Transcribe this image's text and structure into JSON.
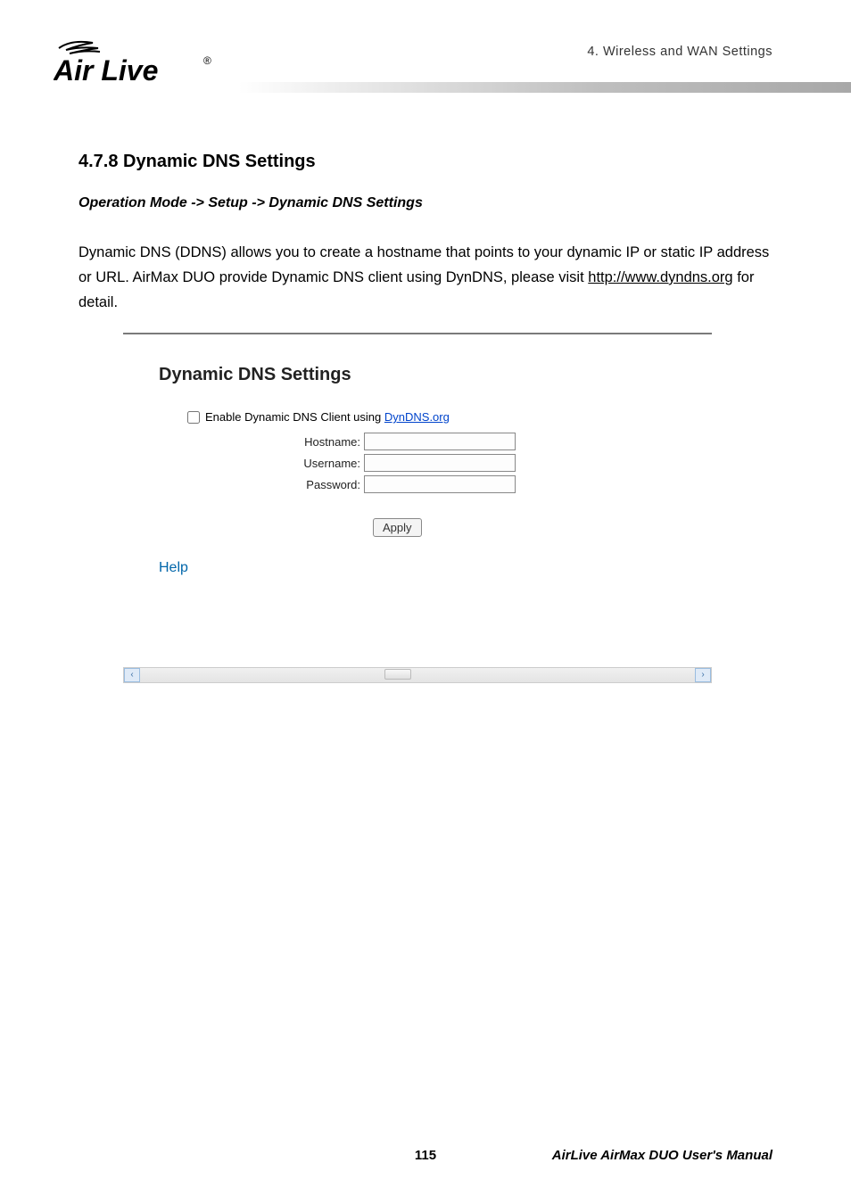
{
  "header": {
    "chapter_label": "4. Wireless and WAN Settings",
    "logo_text_main": "Air Live",
    "logo_reg": "®"
  },
  "content": {
    "section_heading": "4.7.8 Dynamic DNS Settings",
    "breadcrumb": "Operation Mode -> Setup -> Dynamic DNS Settings",
    "body_pre": "Dynamic DNS (DDNS) allows you to create a hostname that points to your dynamic IP or static IP address or URL. AirMax DUO provide Dynamic DNS client using DynDNS, please visit ",
    "body_link": "http://www.dyndns.org",
    "body_post": " for detail."
  },
  "panel": {
    "title": "Dynamic DNS Settings",
    "enable_label_pre": "Enable Dynamic DNS Client using ",
    "enable_link": "DynDNS.org",
    "enable_checked": false,
    "hostname_label": "Hostname:",
    "hostname_value": "",
    "username_label": "Username:",
    "username_value": "",
    "password_label": "Password:",
    "password_value": "",
    "apply_label": "Apply",
    "help_label": "Help"
  },
  "footer": {
    "page_number": "115",
    "manual_name": "AirLive AirMax DUO User's Manual"
  }
}
